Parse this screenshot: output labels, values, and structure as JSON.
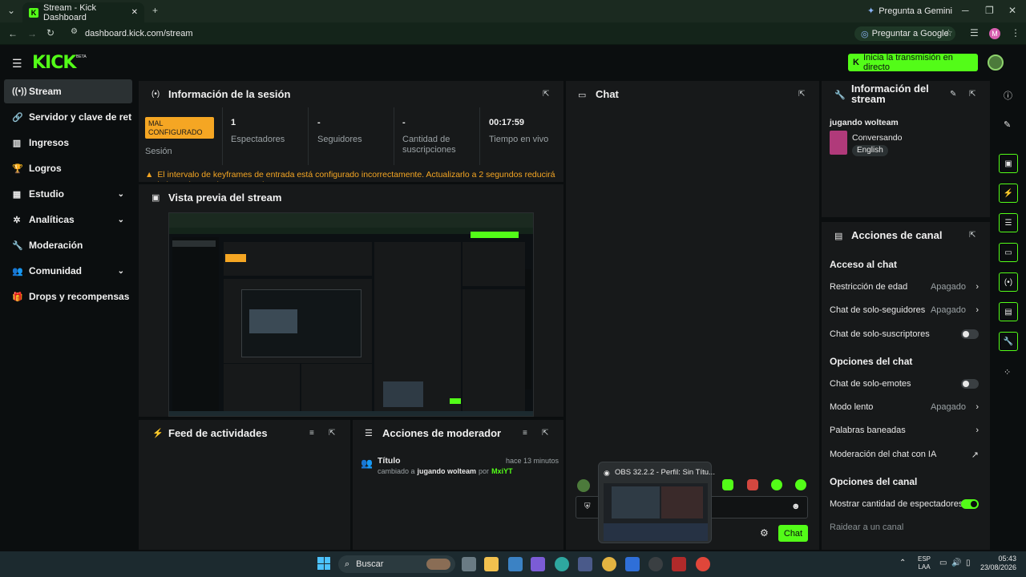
{
  "browser": {
    "tab_title": "Stream - Kick Dashboard",
    "url": "dashboard.kick.com/stream",
    "gemini_label": "Pregunta a Gemini",
    "google_label": "Preguntar a Google",
    "profile_initial": "M"
  },
  "header": {
    "logo": "KICK",
    "beta": "BETA",
    "live_button": "Inicia la transmisión en directo"
  },
  "sidebar": {
    "items": [
      {
        "label": "Stream",
        "icon": "broadcast-icon"
      },
      {
        "label": "Servidor y clave de retransmisión",
        "icon": "link-icon"
      },
      {
        "label": "Ingresos",
        "icon": "chart-bar-icon"
      },
      {
        "label": "Logros",
        "icon": "trophy-icon"
      },
      {
        "label": "Estudio",
        "icon": "grid-icon"
      },
      {
        "label": "Analíticas",
        "icon": "analytics-icon"
      },
      {
        "label": "Moderación",
        "icon": "wrench-icon"
      },
      {
        "label": "Comunidad",
        "icon": "community-icon"
      },
      {
        "label": "Drops y recompensas",
        "icon": "gift-icon"
      }
    ]
  },
  "session": {
    "title": "Información de la sesión",
    "status_badge": "MAL CONFIGURADO",
    "status_label": "Sesión",
    "stats": [
      {
        "value": "1",
        "label": "Espectadores"
      },
      {
        "value": "-",
        "label": "Seguidores"
      },
      {
        "value": "-",
        "label": "Cantidad de suscripciones"
      },
      {
        "value": "00:17:59",
        "label": "Tiempo en vivo"
      }
    ],
    "warning": "El intervalo de keyframes de entrada está configurado incorrectamente. Actualizarlo a 2 segundos reducirá la latencia para los espectadores."
  },
  "preview": {
    "title": "Vista previa del stream"
  },
  "activity": {
    "title": "Feed de actividades"
  },
  "modactions": {
    "title": "Acciones de moderador",
    "entry_title": "Título",
    "entry_time": "hace 13 minutos",
    "entry_prefix": "cambiado a",
    "entry_value": "jugando wolteam",
    "entry_by": "por",
    "entry_user": "MxiYT"
  },
  "chat": {
    "title": "Chat",
    "send_label": "Chat"
  },
  "obs_popup": {
    "title": "OBS 32.2.2 - Perfil: Sin Títu..."
  },
  "stream_info": {
    "title": "Información del stream",
    "stream_title": "jugando wolteam",
    "category": "Conversando",
    "language": "English"
  },
  "channel_actions": {
    "title": "Acciones de canal",
    "sections": [
      {
        "heading": "Acceso al chat"
      },
      {
        "heading": "Opciones del chat"
      },
      {
        "heading": "Opciones del canal"
      }
    ],
    "rows": [
      {
        "label": "Restricción de edad",
        "value": "Apagado"
      },
      {
        "label": "Chat de solo-seguidores",
        "value": "Apagado"
      },
      {
        "label": "Chat de solo-suscriptores",
        "value": ""
      },
      {
        "label": "Chat de solo-emotes",
        "value": ""
      },
      {
        "label": "Modo lento",
        "value": "Apagado"
      },
      {
        "label": "Palabras baneadas",
        "value": ""
      },
      {
        "label": "Moderación del chat con IA",
        "value": ""
      },
      {
        "label": "Mostrar cantidad de espectadores",
        "value": ""
      },
      {
        "label": "Raidear a un canal",
        "value": ""
      }
    ]
  },
  "taskbar": {
    "search_placeholder": "Buscar",
    "lang_top": "ESP",
    "lang_bottom": "LAA",
    "time": "05:43",
    "date": "23/08/2026"
  }
}
